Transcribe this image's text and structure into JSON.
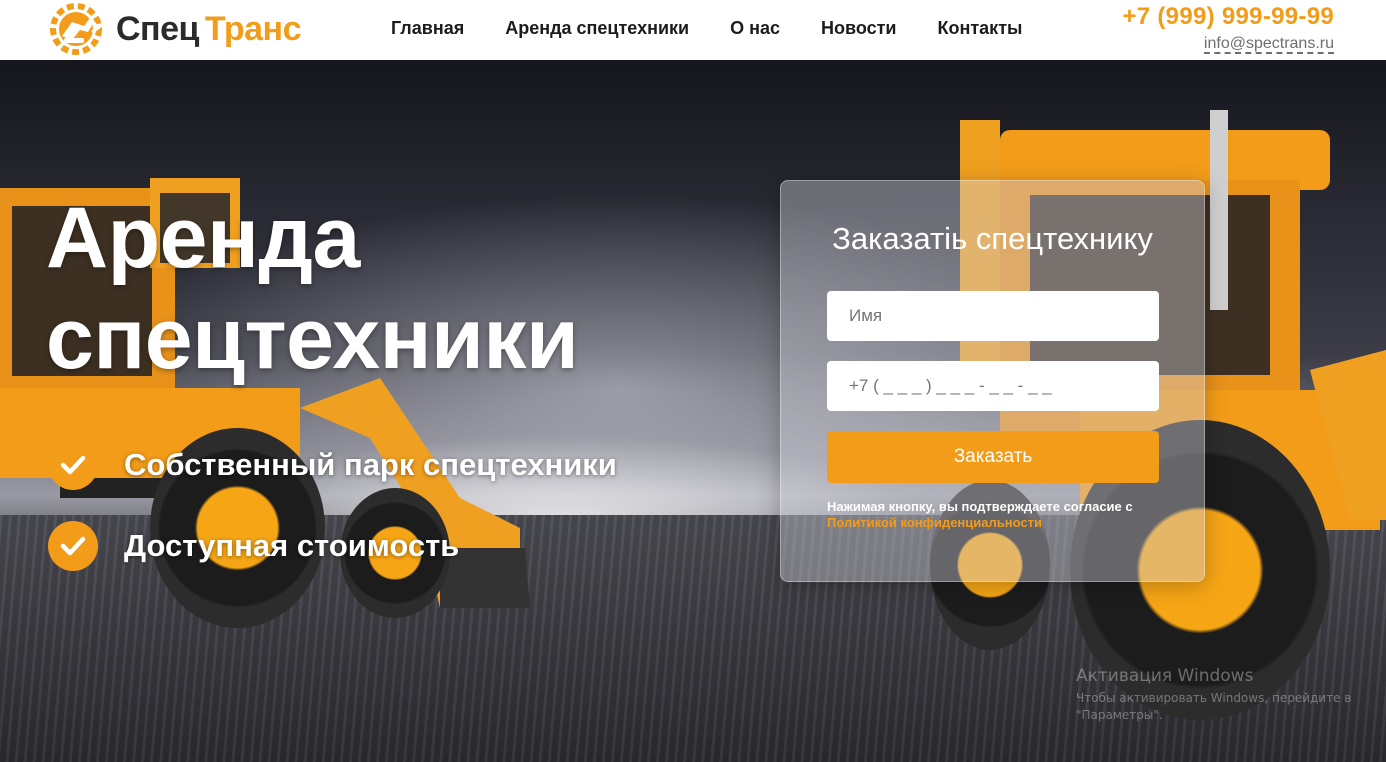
{
  "header": {
    "logo": {
      "part1": "Спец",
      "part2": "Транс",
      "icon": "excavator-gear-icon"
    },
    "nav": [
      "Главная",
      "Аренда спецтехники",
      "О нас",
      "Новости",
      "Контакты"
    ],
    "phone": "+7 (999) 999-99-99",
    "email": "info@spectrans.ru"
  },
  "hero": {
    "title_line1": "Аренда",
    "title_line2": "спецтехники",
    "features": [
      "Собственный парк спецтехники",
      "Доступная стоимость"
    ],
    "feature_icon": "check-icon"
  },
  "form": {
    "title": "Заказатіь спецтехнику",
    "name_placeholder": "Имя",
    "phone_placeholder": "+7 ( _ _ _ ) _ _ _ - _ _ - _ _",
    "submit_label": "Заказать",
    "consent_text": "Нажимая кнопку, вы подтверждаете согласие с ",
    "consent_link": "Политикой конфиденциальности"
  },
  "watermark": {
    "title": "Активация Windows",
    "line1": "Чтобы активировать Windows, перейдите в",
    "line2": "\"Параметры\"."
  },
  "colors": {
    "accent": "#f39c19",
    "dark": "#2b2b2b",
    "white": "#ffffff"
  }
}
